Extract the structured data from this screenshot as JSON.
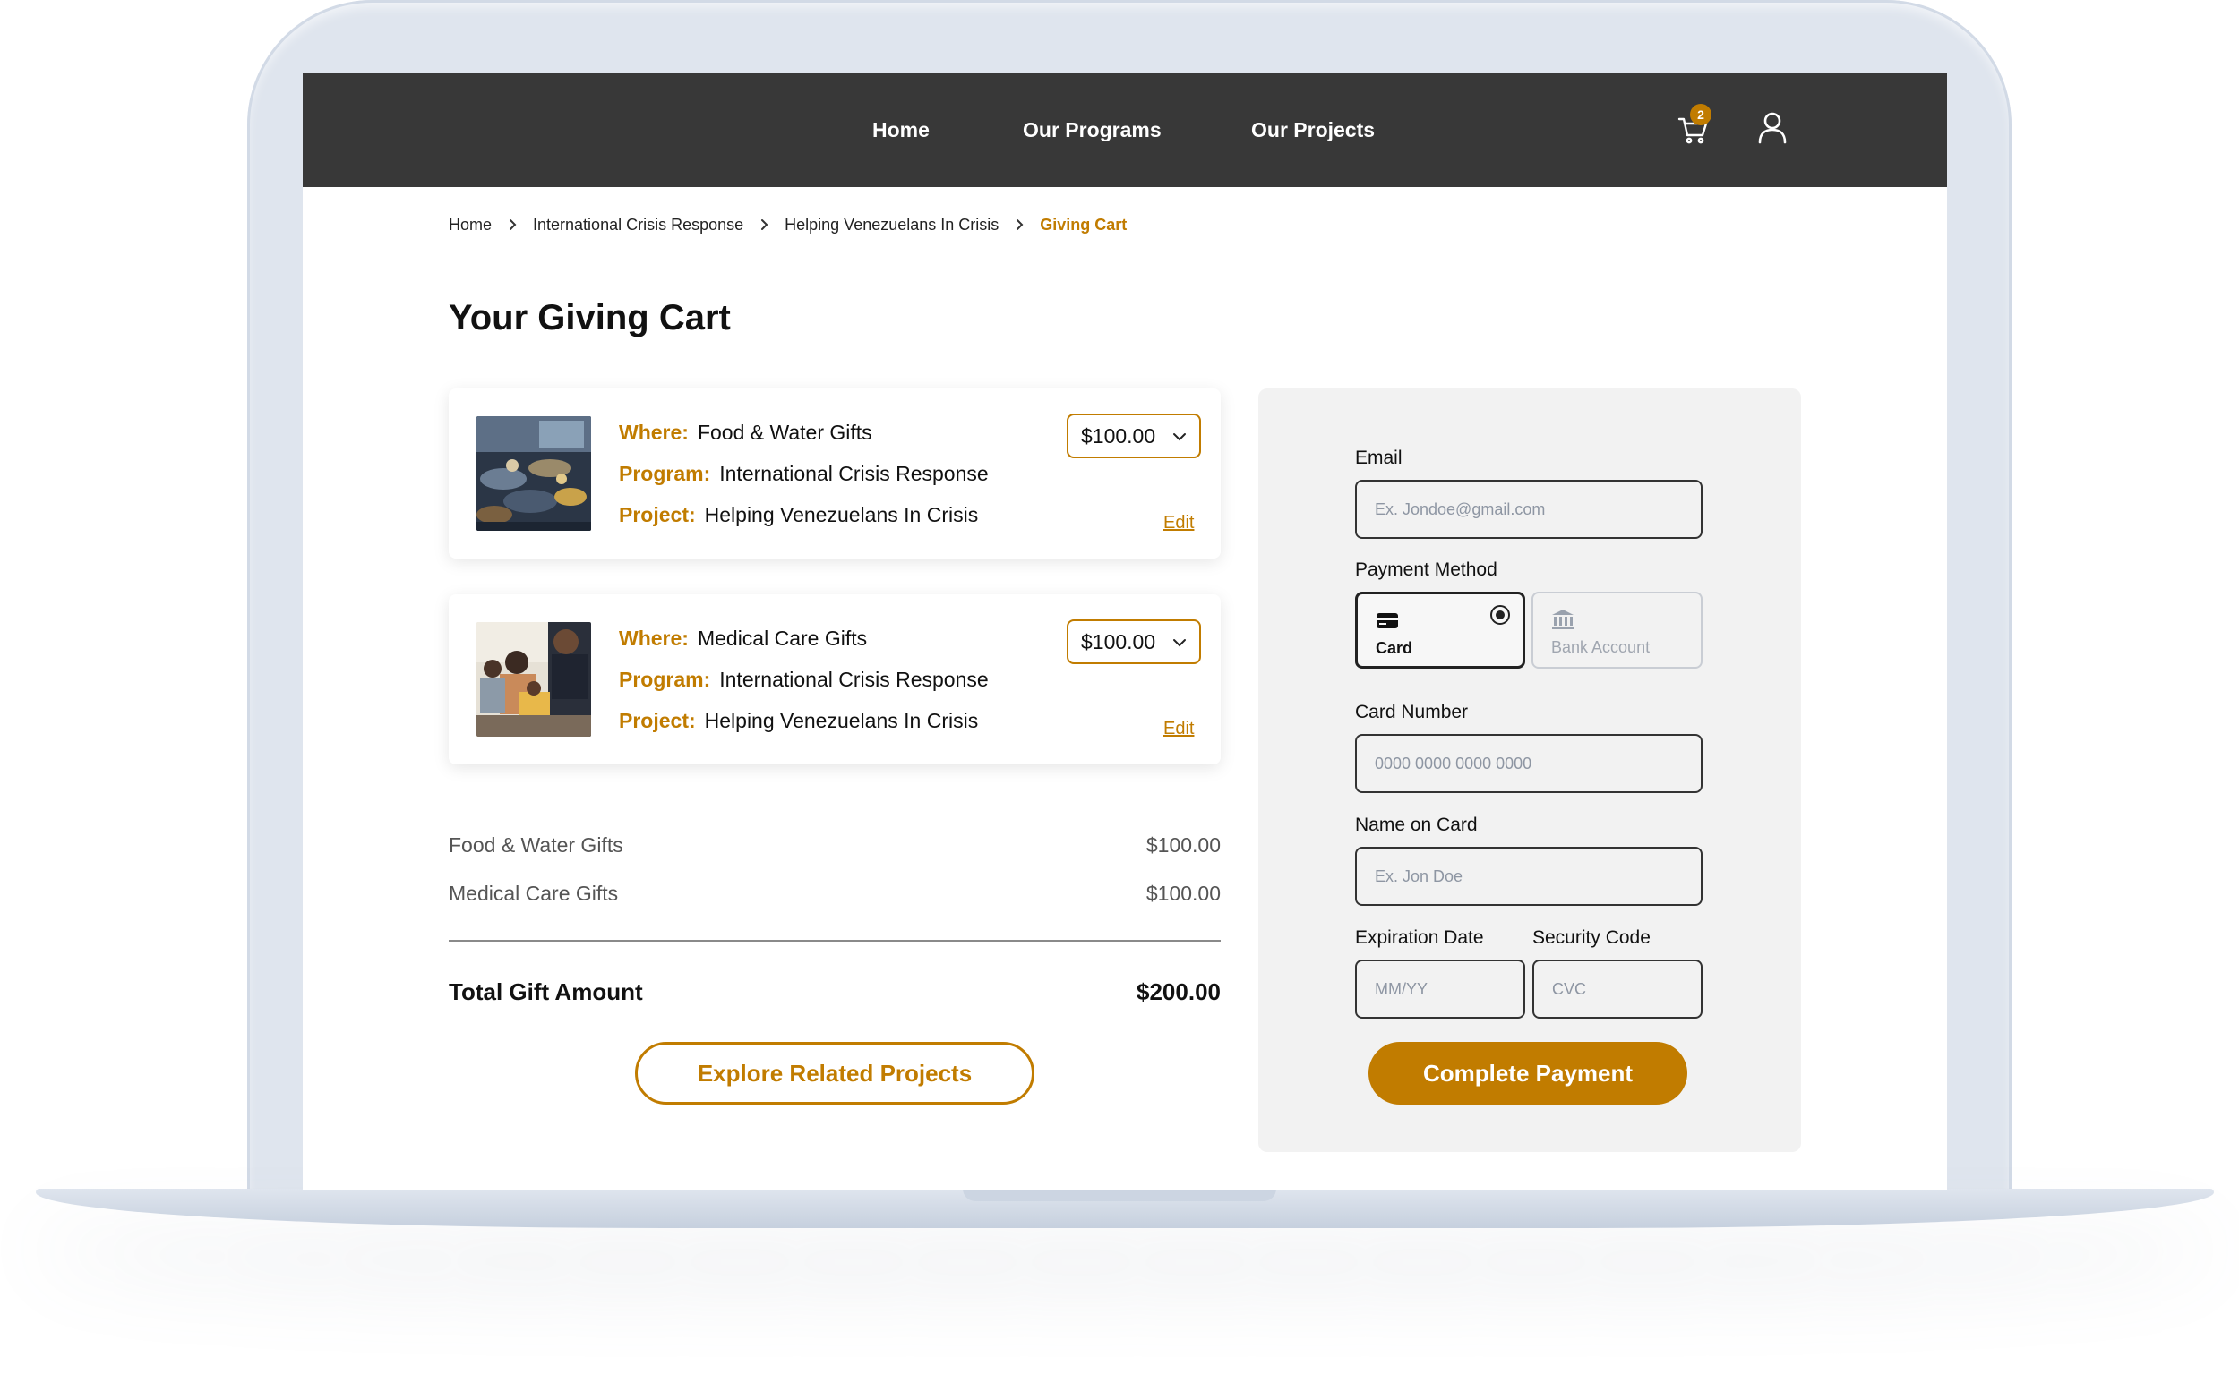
{
  "nav": {
    "home": "Home",
    "programs": "Our Programs",
    "projects": "Our Projects",
    "cart_count": "2",
    "cart_icon": "cart-icon",
    "user_icon": "user-icon"
  },
  "breadcrumb": {
    "items": [
      "Home",
      "International Crisis Response",
      "Helping Venezuelans In Crisis"
    ],
    "current": "Giving Cart"
  },
  "page_title": "Your Giving Cart",
  "cart": {
    "where_label": "Where:",
    "program_label": "Program:",
    "project_label": "Project:",
    "edit_label": "Edit",
    "items": [
      {
        "where": "Food & Water Gifts",
        "program": "International Crisis Response",
        "project": "Helping Venezuelans In Crisis",
        "amount": "$100.00"
      },
      {
        "where": "Medical Care Gifts",
        "program": "International Crisis Response",
        "project": "Helping Venezuelans In Crisis",
        "amount": "$100.00"
      }
    ]
  },
  "summary": {
    "lines": [
      {
        "label": "Food & Water Gifts",
        "amount": "$100.00"
      },
      {
        "label": "Medical Care Gifts",
        "amount": "$100.00"
      }
    ],
    "total_label": "Total Gift Amount",
    "total_amount": "$200.00",
    "explore_label": "Explore Related Projects"
  },
  "payment": {
    "email_label": "Email",
    "email_placeholder": "Ex. Jondoe@gmail.com",
    "method_label": "Payment Method",
    "methods": {
      "card": "Card",
      "bank": "Bank Account"
    },
    "card_number_label": "Card Number",
    "card_number_placeholder": "0000 0000 0000 0000",
    "name_label": "Name on Card",
    "name_placeholder": "Ex. Jon Doe",
    "expiry_label": "Expiration Date",
    "expiry_placeholder": "MM/YY",
    "security_label": "Security Code",
    "security_placeholder": "CVC",
    "submit_label": "Complete Payment"
  },
  "colors": {
    "accent": "#c17c00",
    "header": "#383838",
    "panel": "#f2f2f2"
  }
}
